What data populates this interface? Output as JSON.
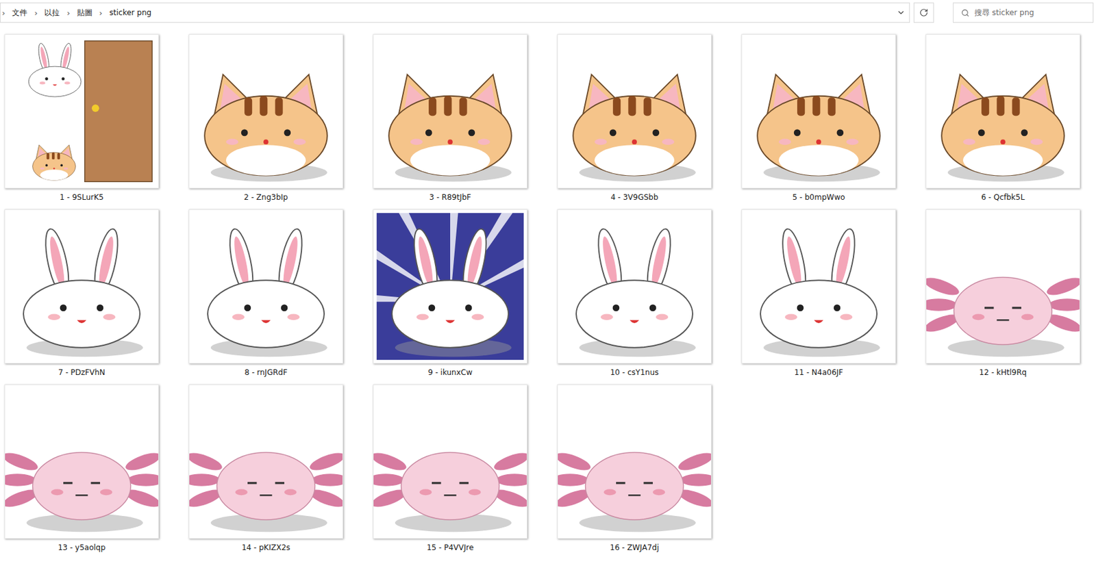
{
  "address": {
    "lead": "›",
    "separator": "›",
    "crumbs": [
      "文件",
      "以拉",
      "貼圖",
      "sticker png"
    ]
  },
  "search": {
    "placeholder": "搜尋 sticker png"
  },
  "files": [
    {
      "name": "1 - 9SLurK5",
      "kind": "door",
      "selected": false
    },
    {
      "name": "2 - Zng3bIp",
      "kind": "cat",
      "selected": false
    },
    {
      "name": "3 - R89tJbF",
      "kind": "cat",
      "selected": false
    },
    {
      "name": "4 - 3V9GSbb",
      "kind": "cat",
      "selected": false
    },
    {
      "name": "5 - b0mpWwo",
      "kind": "cat",
      "selected": false
    },
    {
      "name": "6 - Qcfbk5L",
      "kind": "cat",
      "selected": false
    },
    {
      "name": "7 - PDzFVhN",
      "kind": "rabbit",
      "selected": false
    },
    {
      "name": "8 - rnJGRdF",
      "kind": "rabbit",
      "selected": false
    },
    {
      "name": "9 - ikunxCw",
      "kind": "rays",
      "selected": false
    },
    {
      "name": "10 - csY1nus",
      "kind": "rabbit",
      "selected": false
    },
    {
      "name": "11 - N4a06JF",
      "kind": "rabbit",
      "selected": false
    },
    {
      "name": "12 - kHtl9Rq",
      "kind": "axolotl",
      "selected": false
    },
    {
      "name": "13 - y5aolqp",
      "kind": "axolotl",
      "selected": false
    },
    {
      "name": "14 - pKIZX2s",
      "kind": "axolotl",
      "selected": false
    },
    {
      "name": "15 - P4VVJre",
      "kind": "axolotl",
      "selected": false
    },
    {
      "name": "16 - ZWJA7dj",
      "kind": "axolotl",
      "selected": false
    }
  ]
}
